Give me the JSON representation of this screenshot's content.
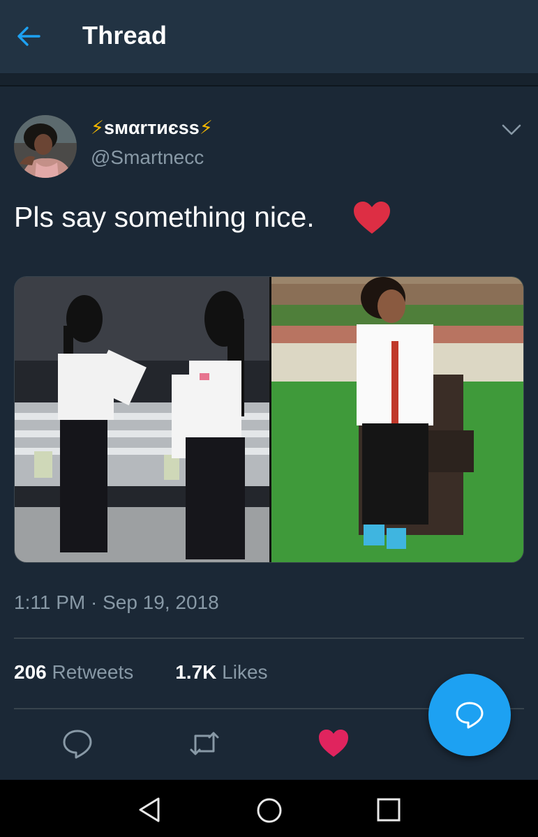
{
  "header": {
    "title": "Thread"
  },
  "tweet": {
    "author": {
      "display_name": "ѕмαrтиєѕѕ",
      "name_decoration": "⚡",
      "handle": "@Smartnecc"
    },
    "text": "Pls say something nice.",
    "emoji": "red-heart",
    "timestamp": "1:11 PM · Sep 19, 2018",
    "stats": {
      "retweets_count": "206",
      "retweets_label": "Retweets",
      "likes_count": "1.7K",
      "likes_label": "Likes"
    },
    "liked": true
  },
  "colors": {
    "accent": "#1da1f2",
    "like": "#e0245e",
    "background": "#1b2836",
    "secondary_text": "#8899a6"
  },
  "icons": {
    "back": "arrow-left-icon",
    "more": "chevron-down-icon",
    "reply": "reply-icon",
    "retweet": "retweet-icon",
    "like": "heart-icon",
    "compose_reply": "speech-bubble-icon",
    "nav_back": "triangle-back-icon",
    "nav_home": "circle-home-icon",
    "nav_recents": "square-recents-icon"
  }
}
